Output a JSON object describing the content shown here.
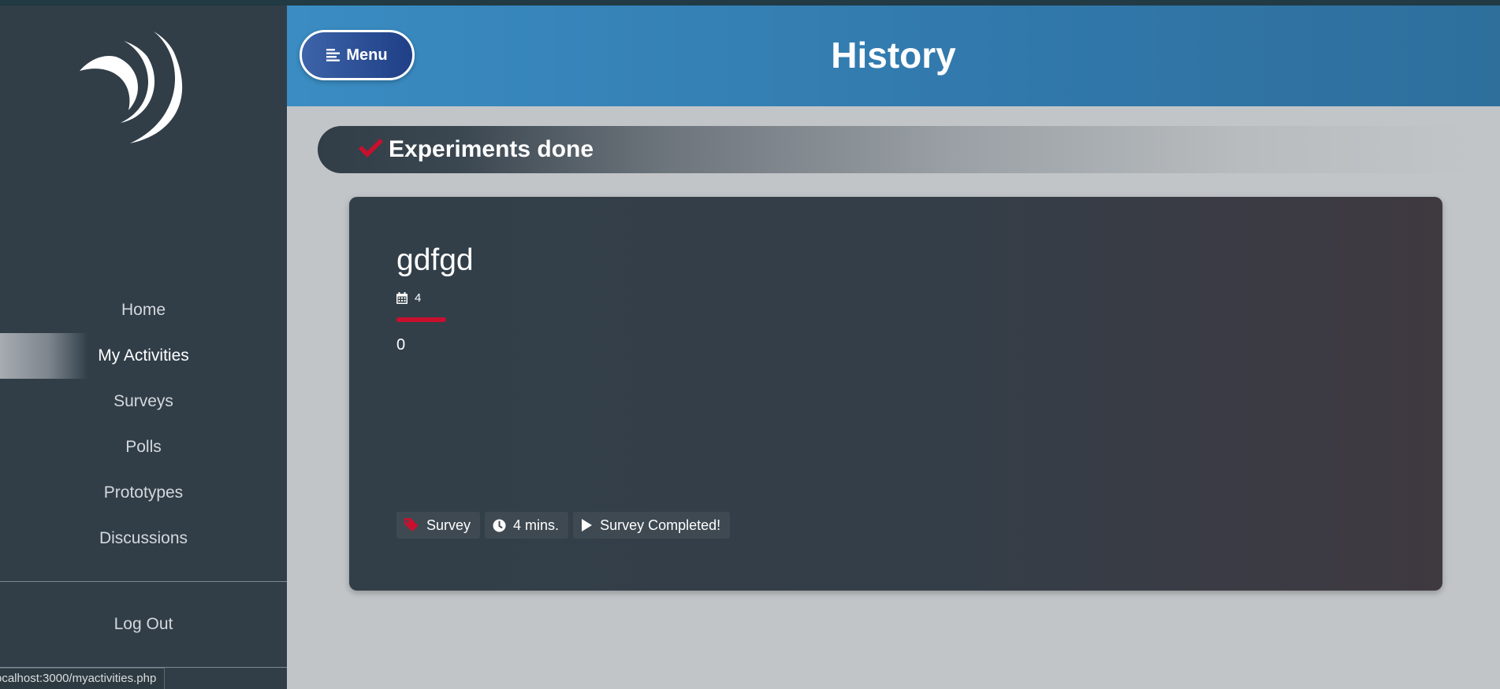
{
  "sidebar": {
    "logo_icon": "crescent-swoosh-logo-icon",
    "nav": [
      {
        "label": "Home",
        "active": false
      },
      {
        "label": "My Activities",
        "active": true
      },
      {
        "label": "Surveys",
        "active": false
      },
      {
        "label": "Polls",
        "active": false
      },
      {
        "label": "Prototypes",
        "active": false
      },
      {
        "label": "Discussions",
        "active": false
      }
    ],
    "logout_label": "Log Out"
  },
  "status_bar": {
    "url": "ocalhost:3000/myactivities.php"
  },
  "header": {
    "menu_label": "Menu",
    "menu_icon": "menu-lines-icon",
    "title": "History"
  },
  "section": {
    "title": "Experiments done",
    "icon": "checkmark-icon"
  },
  "card": {
    "title": "gdfgd",
    "meta_icon": "calendar-icon",
    "meta_value": "4",
    "value": "0",
    "tags": [
      {
        "icon": "tag-icon",
        "label": "Survey"
      },
      {
        "icon": "clock-icon",
        "label": "4 mins."
      },
      {
        "icon": "play-icon",
        "label": "Survey Completed!"
      }
    ]
  },
  "colors": {
    "sidebar_bg": "#313e48",
    "header_blue": "#3178ab",
    "accent_red": "#c8102e",
    "page_bg": "#c1c5c8"
  }
}
